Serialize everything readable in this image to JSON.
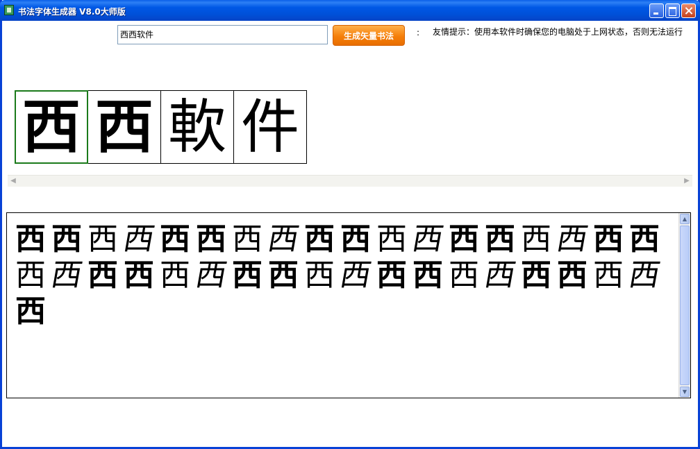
{
  "window": {
    "title": "书法字体生成器 V8.0大师版",
    "icon": "app-icon"
  },
  "toolbar": {
    "input_value": "西西软件",
    "generate_label": "生成矢量书法",
    "separator": ":",
    "tip": "友情提示：使用本软件时确保您的电脑处于上网状态，否则无法运行"
  },
  "preview": {
    "selected_index": 0,
    "chars": [
      "西",
      "西",
      "軟",
      "件"
    ]
  },
  "results": {
    "glyphs": [
      "西",
      "西",
      "西",
      "西",
      "西",
      "西",
      "西",
      "西",
      "西",
      "西",
      "西",
      "西",
      "西",
      "西",
      "西",
      "西",
      "西",
      "西",
      "西",
      "西",
      "西",
      "西",
      "西",
      "西",
      "西",
      "西",
      "西",
      "西",
      "西",
      "西",
      "西",
      "西",
      "西",
      "西",
      "西",
      "西",
      "西"
    ]
  },
  "colors": {
    "titlebar": "#0054e3",
    "generate_button": "#f57f0a",
    "selected_border": "#1a7a1a"
  }
}
